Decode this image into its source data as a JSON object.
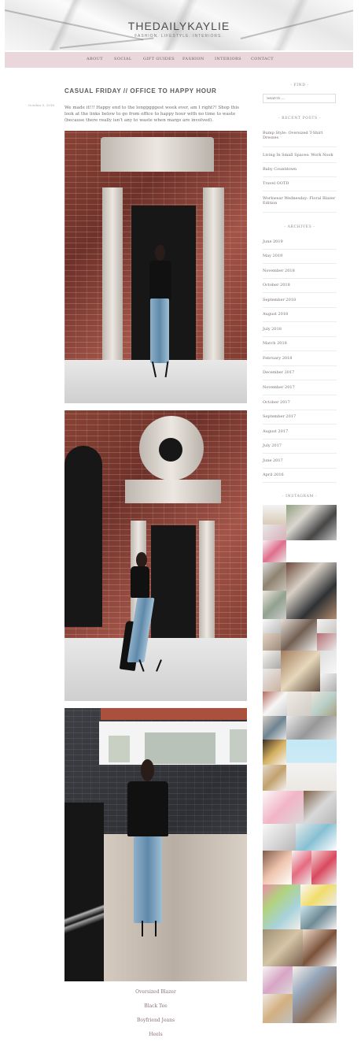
{
  "site": {
    "title": "THEDAILYKAYLIE",
    "tagline": "FASHION. LIFESTYLE. INTERIORS."
  },
  "nav": {
    "items": [
      "ABOUT",
      "SOCIAL",
      "GIFT GUIDES",
      "FASHION",
      "INTERIORS",
      "CONTACT"
    ]
  },
  "post": {
    "title": "CASUAL FRIDAY // OFFICE TO HAPPY HOUR",
    "date": "October 5, 2018",
    "intro": "We made it!!! Happy end to the longggggest week ever, am I right?! Shop this look at the links below to go from office to happy hour with no time to waste (because there really isn’t any to waste when margs are involved).",
    "items": [
      "Oversized Blazer",
      "Black Tee",
      "Boyfriend Jeans",
      "Heels"
    ]
  },
  "sidebar": {
    "find_title": "- FIND -",
    "search_placeholder": "Search ...",
    "recent_title": "- RECENT POSTS -",
    "recent_posts": [
      "Bump Style: Oversized T-Shirt Dresses",
      "Living In Small Spaces: Work Nook",
      "Baby Countdown",
      "Travel OOTD",
      "Workwear Wednesday: Floral Blazer Edition"
    ],
    "archives_title": "- ARCHIVES -",
    "archives": [
      "June 2019",
      "May 2019",
      "November 2018",
      "October 2018",
      "September 2018",
      "August 2018",
      "July 2018",
      "March 2018",
      "February 2018",
      "December 2017",
      "November 2017",
      "October 2017",
      "September 2017",
      "August 2017",
      "July 2017",
      "June 2017",
      "April 2016"
    ],
    "instagram_title": "- INSTAGRAM -"
  },
  "colors": {
    "nav_bg": "#ead7dc",
    "accent": "#8a7378",
    "text": "#6d6d6d"
  }
}
